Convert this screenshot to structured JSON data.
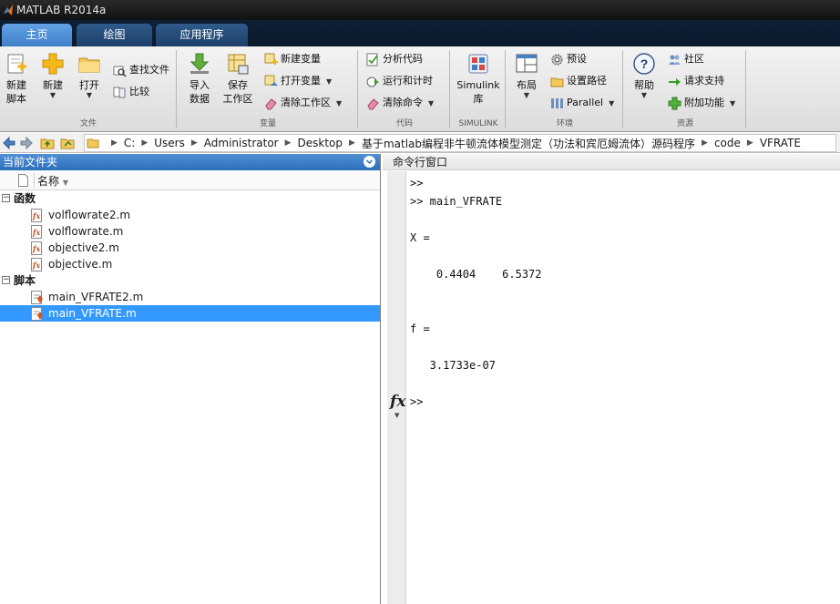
{
  "window": {
    "title": "MATLAB R2014a"
  },
  "tabs": [
    {
      "label": "主页",
      "active": true
    },
    {
      "label": "绘图",
      "active": false
    },
    {
      "label": "应用程序",
      "active": false
    }
  ],
  "ribbon": {
    "file": {
      "label": "文件",
      "new_script_line1": "新建",
      "new_script_line2": "脚本",
      "new": "新建",
      "open": "打开",
      "find_files": "查找文件",
      "compare": "比较"
    },
    "variable": {
      "label": "变量",
      "import_line1": "导入",
      "import_line2": "数据",
      "save_ws_line1": "保存",
      "save_ws_line2": "工作区",
      "new_variable": "新建变量",
      "open_variable": "打开变量",
      "clear_workspace": "清除工作区"
    },
    "code": {
      "label": "代码",
      "analyze_code": "分析代码",
      "run_and_time": "运行和计时",
      "clear_commands": "清除命令"
    },
    "simulink": {
      "label": "SIMULINK",
      "library_line1": "Simulink",
      "library_line2": "库"
    },
    "environment": {
      "label": "环境",
      "layout": "布局",
      "preferences": "预设",
      "set_path": "设置路径",
      "parallel": "Parallel"
    },
    "resources": {
      "label": "资源",
      "help": "帮助",
      "community": "社区",
      "request_support": "请求支持",
      "add_ons": "附加功能"
    },
    "colors": {
      "tab_active": "#4a8fd8",
      "tab_inactive": "#24497a",
      "selection": "#3399ff"
    }
  },
  "address": {
    "crumbs": [
      "C:",
      "Users",
      "Administrator",
      "Desktop",
      "基于matlab编程非牛顿流体模型测定（功法和宾厄姆流体）源码程序",
      "code",
      "VFRATE"
    ]
  },
  "current_folder": {
    "title": "当前文件夹",
    "column_name": "名称",
    "sections": [
      {
        "name": "函数",
        "files": [
          "volflowrate2.m",
          "volflowrate.m",
          "objective2.m",
          "objective.m"
        ]
      },
      {
        "name": "脚本",
        "files": [
          "main_VFRATE2.m",
          "main_VFRATE.m"
        ]
      }
    ],
    "selected_file": "main_VFRATE.m"
  },
  "command_window": {
    "title": "命令行窗口",
    "lines": [
      ">>",
      ">> main_VFRATE",
      "X =",
      "    0.4404    6.5372",
      "f =",
      "   3.1733e-07",
      ">>"
    ],
    "fx": "fx"
  }
}
